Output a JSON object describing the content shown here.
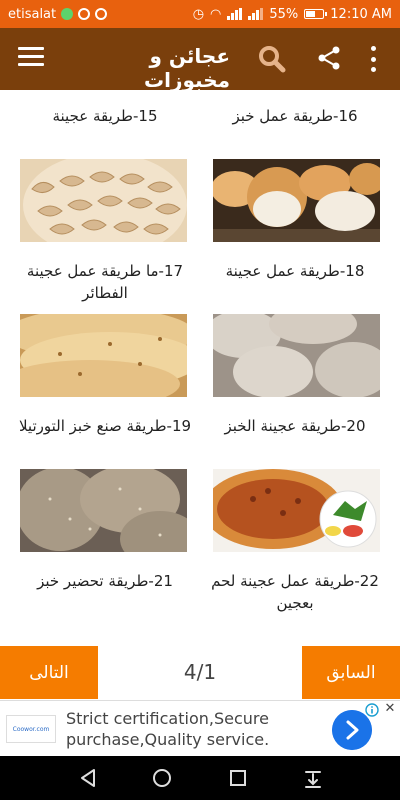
{
  "status_bar": {
    "carrier": "etisalat",
    "signal_tag": "4G",
    "battery": "55%",
    "battery_level": 0.55,
    "time": "12:10 AM"
  },
  "app_bar": {
    "title": "عجائن و مخبوزات",
    "icons": [
      "menu-icon",
      "search-icon",
      "share-icon",
      "more-vert-icon"
    ]
  },
  "recipes": [
    {
      "number": "15",
      "title": "15-طريقة عجينة",
      "image": "none"
    },
    {
      "number": "16",
      "title": "16-طريقة عمل خبز",
      "image": "none"
    },
    {
      "number": "17",
      "title": "17-ما طريقة عمل عجينة الفطائر",
      "image": "fried-pastries-photo"
    },
    {
      "number": "18",
      "title": "18-طريقة عمل عجينة",
      "image": "bread-rolls-photo"
    },
    {
      "number": "19",
      "title": "19-طريقة صنع خبز التورتيلا",
      "image": "tortilla-photo"
    },
    {
      "number": "20",
      "title": "20-طريقة عجينة الخبز",
      "image": "dough-circles-photo"
    },
    {
      "number": "21",
      "title": "21-طريقة تحضير خبز",
      "image": "sesame-bread-photo"
    },
    {
      "number": "22",
      "title": "22-طريقة عمل عجينة لحم بعجين",
      "image": "lahm-bajeen-photo"
    }
  ],
  "footer": {
    "next_label": "التالى",
    "prev_label": "السابق",
    "page_indicator": "4/1"
  },
  "ad": {
    "logo_text": "Coowor.com",
    "text": "Strict certification,Secure purchase,Quality service."
  },
  "colors": {
    "status_bar": "#E8610E",
    "app_bar": "#7A3F0C",
    "nav_button": "#F57C00",
    "ad_cta": "#1a73e8"
  }
}
